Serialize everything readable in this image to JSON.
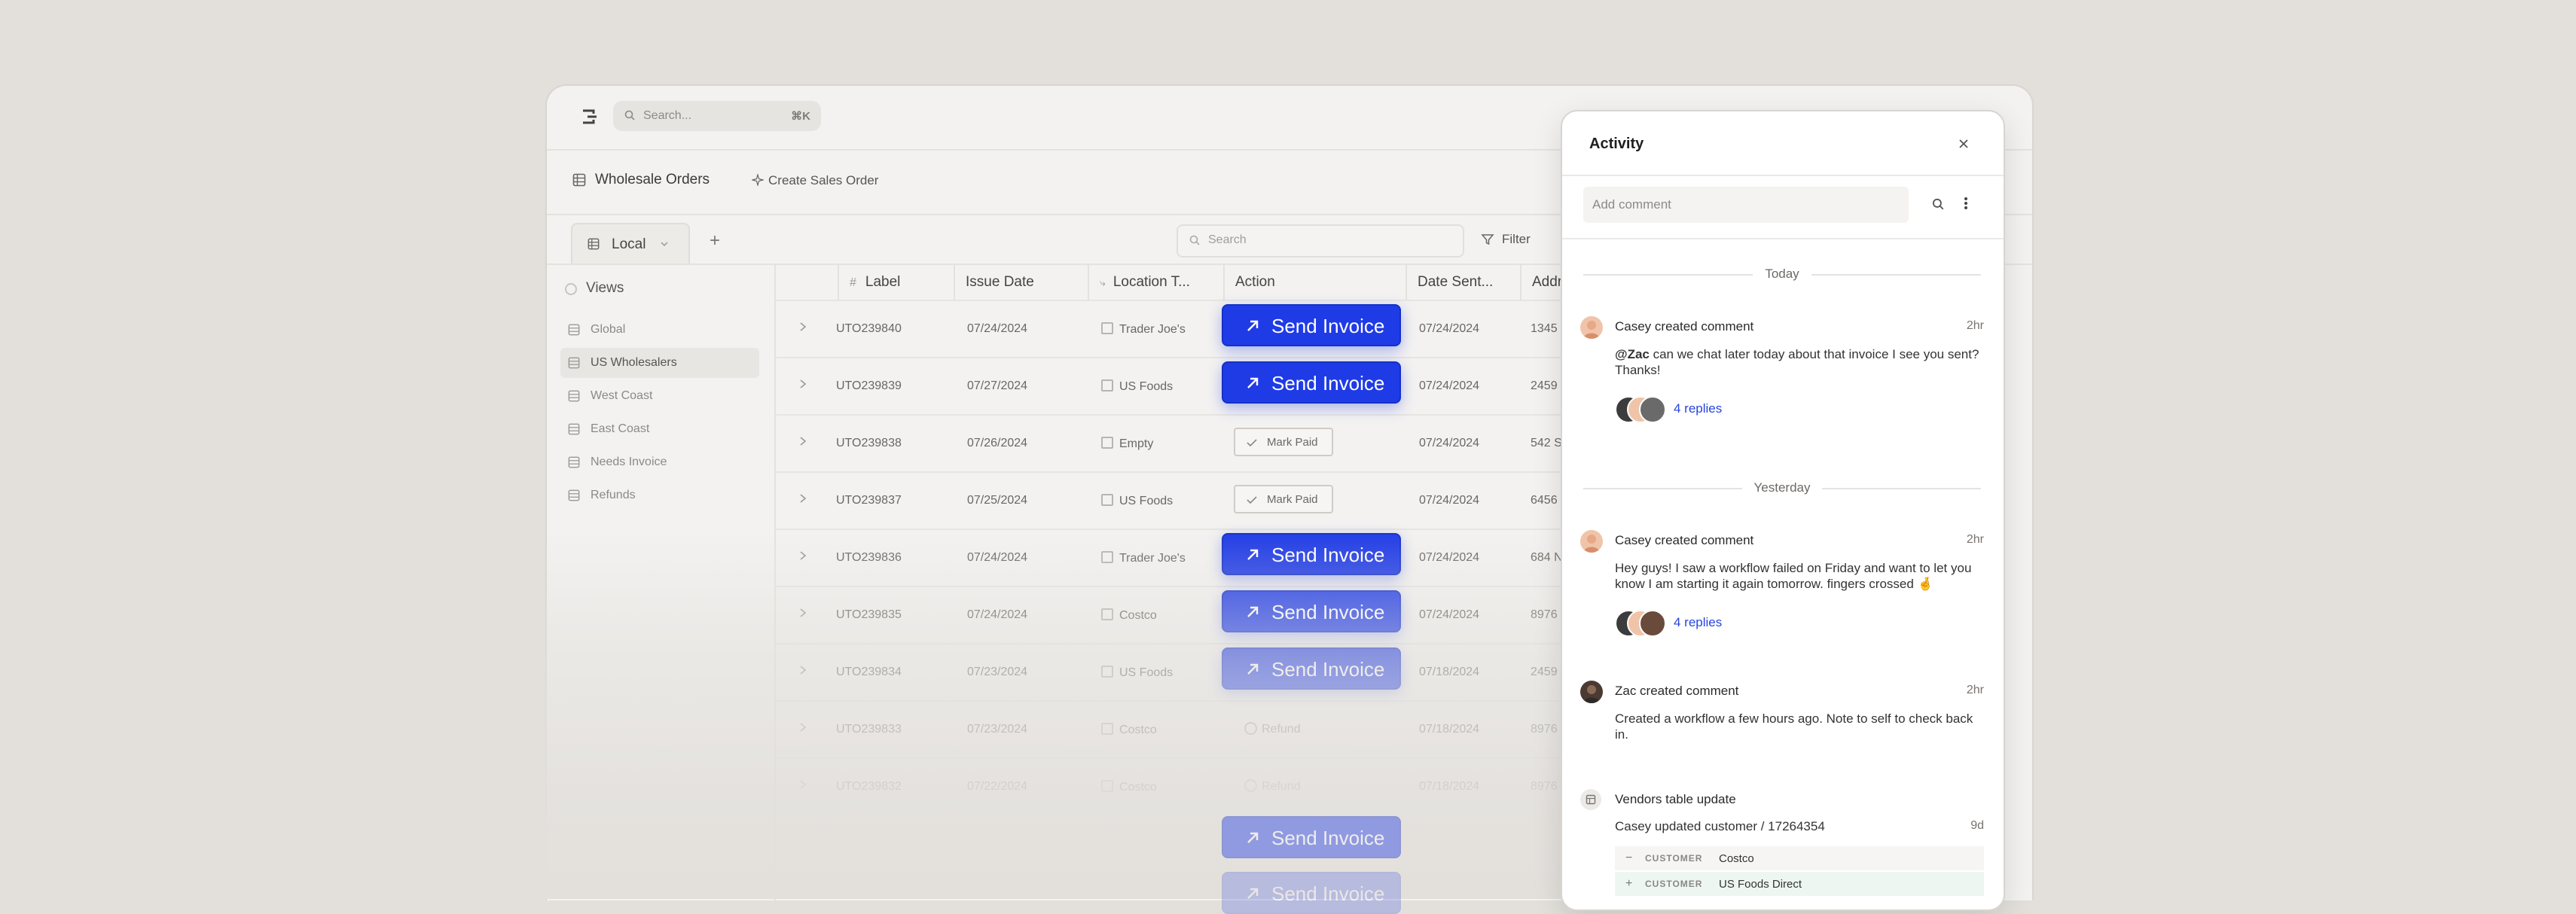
{
  "app": {
    "search_placeholder": "Search...",
    "search_shortcut": "⌘K"
  },
  "breadcrumb": {
    "title": "Wholesale Orders",
    "create_label": "Create Sales Order"
  },
  "tabs": {
    "active": "Local",
    "add": "+"
  },
  "table_search_placeholder": "Search",
  "filter_label": "Filter",
  "views": {
    "header": "Views",
    "items": [
      {
        "label": "Global"
      },
      {
        "label": "US Wholesalers"
      },
      {
        "label": "West Coast"
      },
      {
        "label": "East Coast"
      },
      {
        "label": "Needs Invoice"
      },
      {
        "label": "Refunds"
      }
    ]
  },
  "columns": {
    "label": "Label",
    "issue_date": "Issue Date",
    "location": "Location T...",
    "action": "Action",
    "date_sent": "Date Sent...",
    "address": "Addr"
  },
  "rows": [
    {
      "label": "UTO239840",
      "issue_date": "07/24/2024",
      "location": "Trader Joe's",
      "action": "send",
      "date_sent": "07/24/2024",
      "address": "1345"
    },
    {
      "label": "UTO239839",
      "issue_date": "07/27/2024",
      "location": "US Foods",
      "action": "send",
      "date_sent": "07/24/2024",
      "address": "2459"
    },
    {
      "label": "UTO239838",
      "issue_date": "07/26/2024",
      "location": "Empty",
      "action": "mark",
      "date_sent": "07/24/2024",
      "address": "542 S"
    },
    {
      "label": "UTO239837",
      "issue_date": "07/25/2024",
      "location": "US Foods",
      "action": "mark",
      "date_sent": "07/24/2024",
      "address": "6456"
    },
    {
      "label": "UTO239836",
      "issue_date": "07/24/2024",
      "location": "Trader Joe's",
      "action": "send",
      "date_sent": "07/24/2024",
      "address": "684 N"
    },
    {
      "label": "UTO239835",
      "issue_date": "07/24/2024",
      "location": "Costco",
      "action": "send",
      "date_sent": "07/24/2024",
      "address": "8976"
    },
    {
      "label": "UTO239834",
      "issue_date": "07/23/2024",
      "location": "US Foods",
      "action": "send",
      "date_sent": "07/18/2024",
      "address": "2459"
    },
    {
      "label": "UTO239833",
      "issue_date": "07/23/2024",
      "location": "Costco",
      "action": "refund",
      "date_sent": "07/18/2024",
      "address": "8976"
    },
    {
      "label": "UTO239832",
      "issue_date": "07/22/2024",
      "location": "Costco",
      "action": "refund",
      "date_sent": "07/18/2024",
      "address": "8976"
    }
  ],
  "actions": {
    "send_invoice": "Send Invoice",
    "mark_paid": "Mark Paid",
    "refund": "Refund"
  },
  "activity": {
    "title": "Activity",
    "add_comment_placeholder": "Add comment",
    "sections": {
      "today": "Today",
      "yesterday": "Yesterday"
    },
    "comments": [
      {
        "author_line": "Casey created comment",
        "time": "2hr",
        "mention": "@Zac",
        "body": " can we chat later today about that invoice I see you sent? Thanks!",
        "replies": "4 replies"
      },
      {
        "author_line": "Casey created comment",
        "time": "2hr",
        "body": "Hey guys! I saw a workflow failed on Friday and want to let you know I am starting it again tomorrow. fingers crossed 🤞",
        "replies": "4 replies"
      },
      {
        "author_line": "Zac created comment",
        "time": "2hr",
        "body": "Created a workflow a few hours ago. Note to self to check back in."
      }
    ],
    "vendor_update": {
      "title": "Vendors table update",
      "subtitle": "Casey updated customer /   17264354",
      "time": "9d",
      "diff_key": "CUSTOMER",
      "removed": "Costco",
      "added": "US Foods Direct"
    }
  },
  "colors": {
    "accent": "#1f3be6",
    "link": "#2744e0",
    "background": "#e3e0dc",
    "diff_added_bg": "#eef6f1",
    "diff_removed_bg": "#f6f5f3"
  }
}
